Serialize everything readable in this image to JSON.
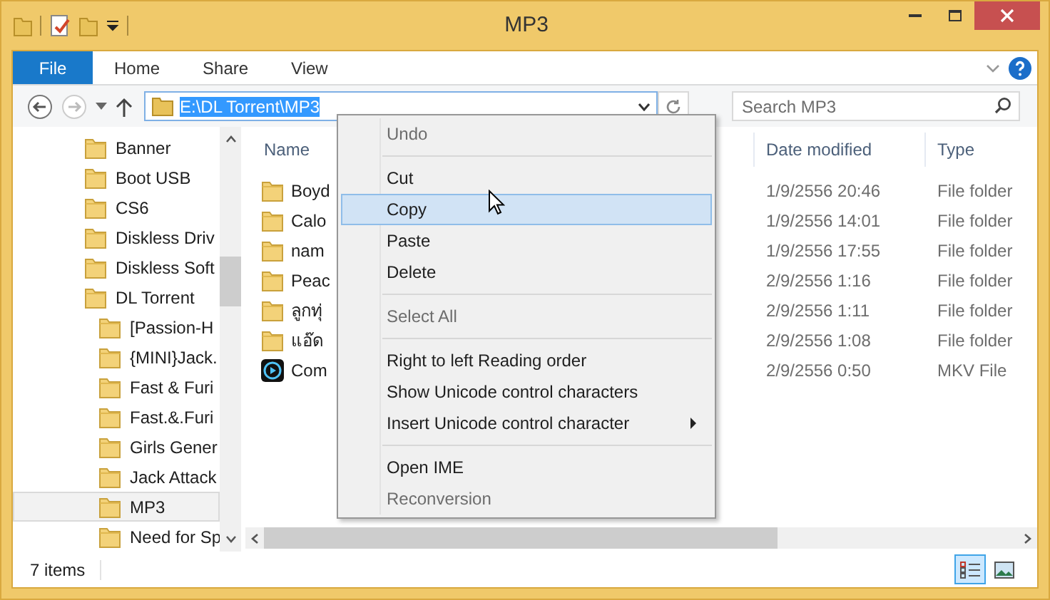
{
  "window": {
    "title": "MP3"
  },
  "ribbon_tabs": [
    {
      "label": "File",
      "kind": "file",
      "selected": false
    },
    {
      "label": "Home",
      "kind": "tab",
      "selected": false
    },
    {
      "label": "Share",
      "kind": "tab",
      "selected": false
    },
    {
      "label": "View",
      "kind": "tab",
      "selected": false
    }
  ],
  "address": {
    "path": "E:\\DL Torrent\\MP3",
    "text_selected": true
  },
  "search": {
    "placeholder": "Search MP3"
  },
  "navigation": [
    {
      "label": "Banner",
      "selected": false
    },
    {
      "label": "Boot USB",
      "selected": false
    },
    {
      "label": "CS6",
      "selected": false
    },
    {
      "label": "Diskless Driv",
      "selected": false
    },
    {
      "label": "Diskless Soft",
      "selected": false
    },
    {
      "label": "DL Torrent",
      "selected": false,
      "children": [
        {
          "label": "[Passion-H",
          "selected": false
        },
        {
          "label": "{MINI}Jack.",
          "selected": false
        },
        {
          "label": "Fast & Furi",
          "selected": false
        },
        {
          "label": "Fast.&.Furi",
          "selected": false
        },
        {
          "label": "Girls Gener",
          "selected": false
        },
        {
          "label": "Jack Attack",
          "selected": false
        },
        {
          "label": "MP3",
          "selected": true
        },
        {
          "label": "Need for Sp",
          "selected": false
        }
      ]
    }
  ],
  "columns": [
    "Name",
    "Date modified",
    "Type"
  ],
  "rows": [
    {
      "kind": "folder",
      "name": "Boyd",
      "date": "1/9/2556 20:46",
      "type": "File folder"
    },
    {
      "kind": "folder",
      "name": "Calo",
      "date": "1/9/2556 14:01",
      "type": "File folder"
    },
    {
      "kind": "folder",
      "name": "nam",
      "date": "1/9/2556 17:55",
      "type": "File folder"
    },
    {
      "kind": "folder",
      "name": "Peac",
      "date": "2/9/2556 1:16",
      "type": "File folder"
    },
    {
      "kind": "folder",
      "name": "ลูกทุ่",
      "date": "2/9/2556 1:11",
      "type": "File folder"
    },
    {
      "kind": "folder",
      "name": "แอ๊ด",
      "date": "2/9/2556 1:08",
      "type": "File folder"
    },
    {
      "kind": "video",
      "name": "Com",
      "date": "2/9/2556 0:50",
      "type": "MKV File"
    }
  ],
  "context_menu": [
    {
      "kind": "item",
      "label": "Undo",
      "disabled": true,
      "selected": false,
      "submenu": false
    },
    {
      "kind": "separator"
    },
    {
      "kind": "item",
      "label": "Cut",
      "disabled": false,
      "selected": false,
      "submenu": false
    },
    {
      "kind": "item",
      "label": "Copy",
      "disabled": false,
      "selected": true,
      "submenu": false
    },
    {
      "kind": "item",
      "label": "Paste",
      "disabled": false,
      "selected": false,
      "submenu": false
    },
    {
      "kind": "item",
      "label": "Delete",
      "disabled": false,
      "selected": false,
      "submenu": false
    },
    {
      "kind": "separator"
    },
    {
      "kind": "item",
      "label": "Select All",
      "disabled": true,
      "selected": false,
      "submenu": false
    },
    {
      "kind": "separator"
    },
    {
      "kind": "item",
      "label": "Right to left Reading order",
      "disabled": false,
      "selected": false,
      "submenu": false
    },
    {
      "kind": "item",
      "label": "Show Unicode control characters",
      "disabled": false,
      "selected": false,
      "submenu": false
    },
    {
      "kind": "item",
      "label": "Insert Unicode control character",
      "disabled": false,
      "selected": false,
      "submenu": true
    },
    {
      "kind": "separator"
    },
    {
      "kind": "item",
      "label": "Open IME",
      "disabled": false,
      "selected": false,
      "submenu": false
    },
    {
      "kind": "item",
      "label": "Reconversion",
      "disabled": true,
      "selected": false,
      "submenu": false
    }
  ],
  "status_bar": {
    "text": "7 items",
    "views": [
      {
        "kind": "details",
        "selected": true
      },
      {
        "kind": "large-icons",
        "selected": false
      }
    ]
  }
}
